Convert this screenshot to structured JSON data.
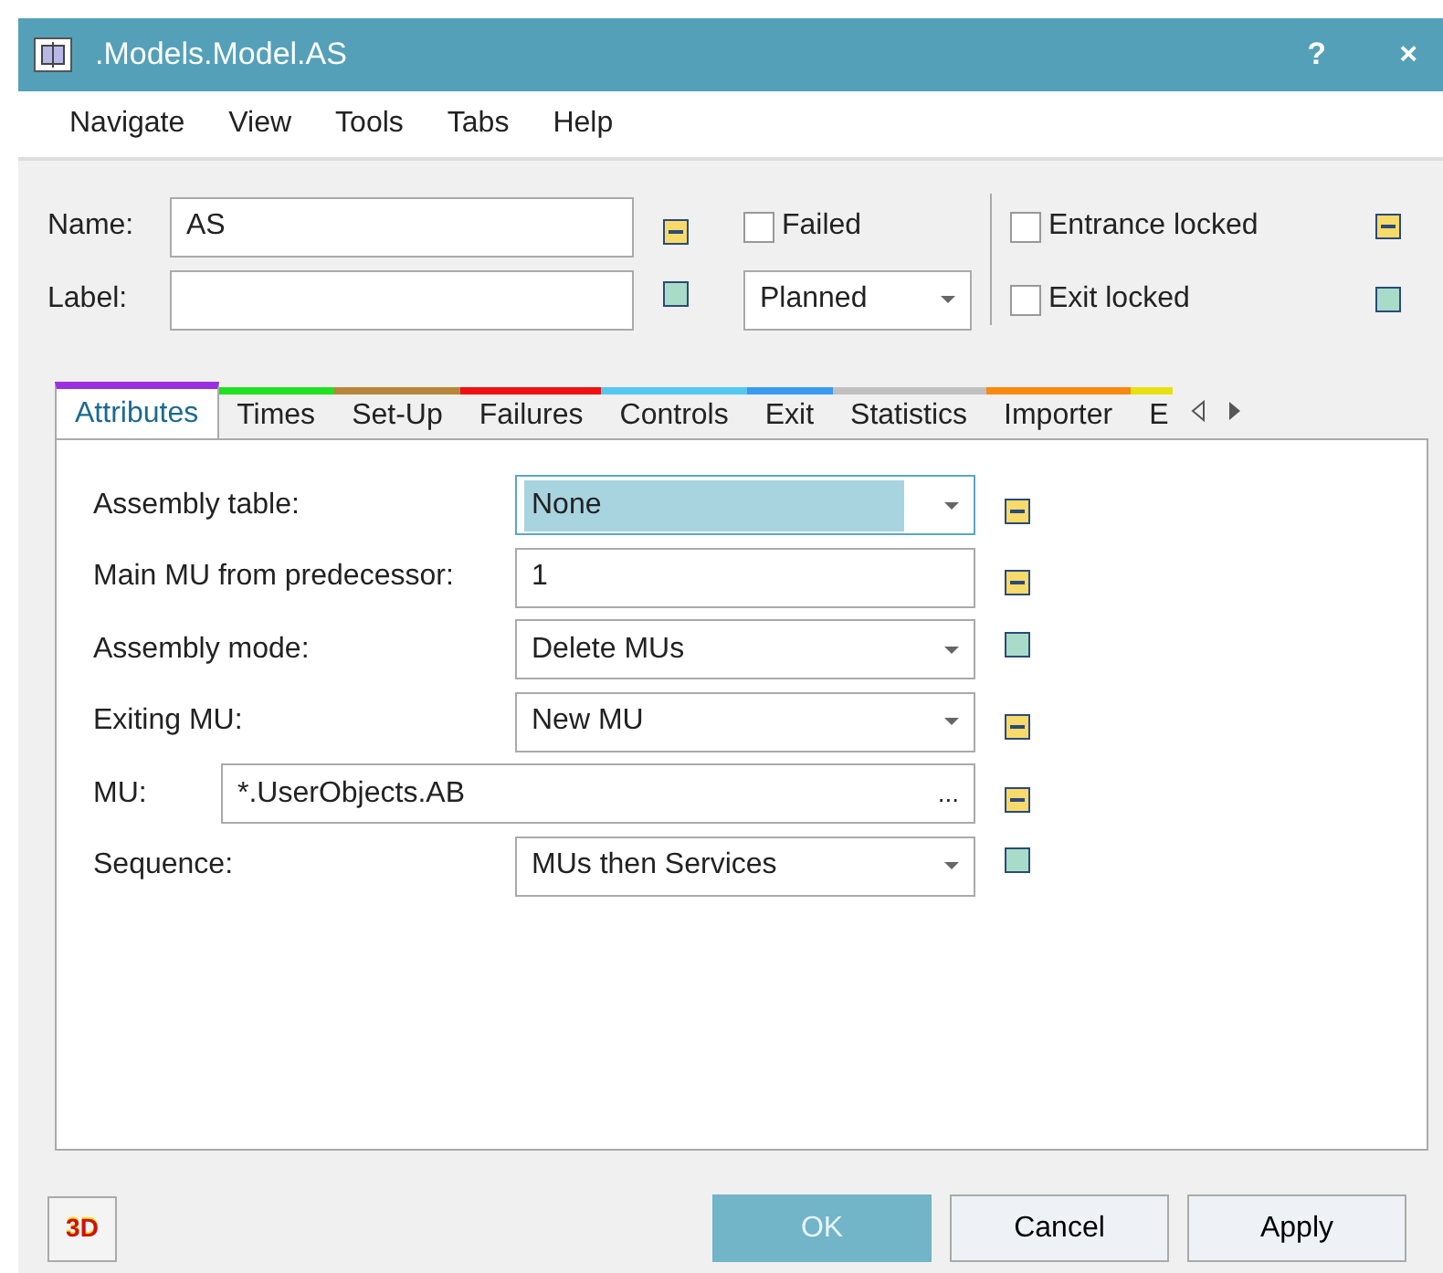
{
  "window": {
    "title": ".Models.Model.AS",
    "help_button": "?",
    "close_button": "×"
  },
  "menu": [
    "Navigate",
    "View",
    "Tools",
    "Tabs",
    "Help"
  ],
  "header": {
    "name": {
      "label": "Name:",
      "value": "AS",
      "inherited": true
    },
    "label": {
      "label": "Label:",
      "inherited": false
    },
    "failed": {
      "label": "Failed",
      "checked": false
    },
    "plan": {
      "value": "Planned"
    },
    "entrance_locked": {
      "label": "Entrance locked",
      "checked": false,
      "inherited": true
    },
    "exit_locked": {
      "label": "Exit locked",
      "checked": false,
      "inherited": false
    }
  },
  "tabs": [
    {
      "label": "Attributes",
      "color": "#9b30e0",
      "selected": true
    },
    {
      "label": "Times",
      "color": "#22e022",
      "selected": false
    },
    {
      "label": "Set-Up",
      "color": "#b8863a",
      "selected": false
    },
    {
      "label": "Failures",
      "color": "#f01010",
      "selected": false
    },
    {
      "label": "Controls",
      "color": "#55c8f0",
      "selected": false
    },
    {
      "label": "Exit",
      "color": "#3a9af0",
      "selected": false
    },
    {
      "label": "Statistics",
      "color": "#c0c0c0",
      "selected": false
    },
    {
      "label": "Importer",
      "color": "#f88a10",
      "selected": false
    },
    {
      "label": "E",
      "color": "#e8e010",
      "selected": false
    }
  ],
  "fields": [
    {
      "label": "Assembly table:",
      "kind": "combo",
      "value": "None",
      "focused": true,
      "inherited": true
    },
    {
      "label": "Main MU from predecessor:",
      "kind": "text",
      "value": "1",
      "focused": false,
      "inherited": true
    },
    {
      "label": "Assembly mode:",
      "kind": "combo",
      "value": "Delete MUs",
      "focused": false,
      "inherited": false
    },
    {
      "label": "Exiting MU:",
      "kind": "combo",
      "value": "New MU",
      "focused": false,
      "inherited": true
    },
    {
      "label": "MU:",
      "kind": "browse",
      "value": "*.UserObjects.AB",
      "browse": "...",
      "focused": false,
      "inherited": true
    },
    {
      "label": "Sequence:",
      "kind": "combo",
      "value": "MUs then Services",
      "focused": false,
      "inherited": false
    }
  ],
  "footer": {
    "three_d": "3D",
    "buttons": [
      {
        "label": "OK",
        "default": true
      },
      {
        "label": "Cancel",
        "default": false
      },
      {
        "label": "Apply",
        "default": false
      }
    ]
  }
}
